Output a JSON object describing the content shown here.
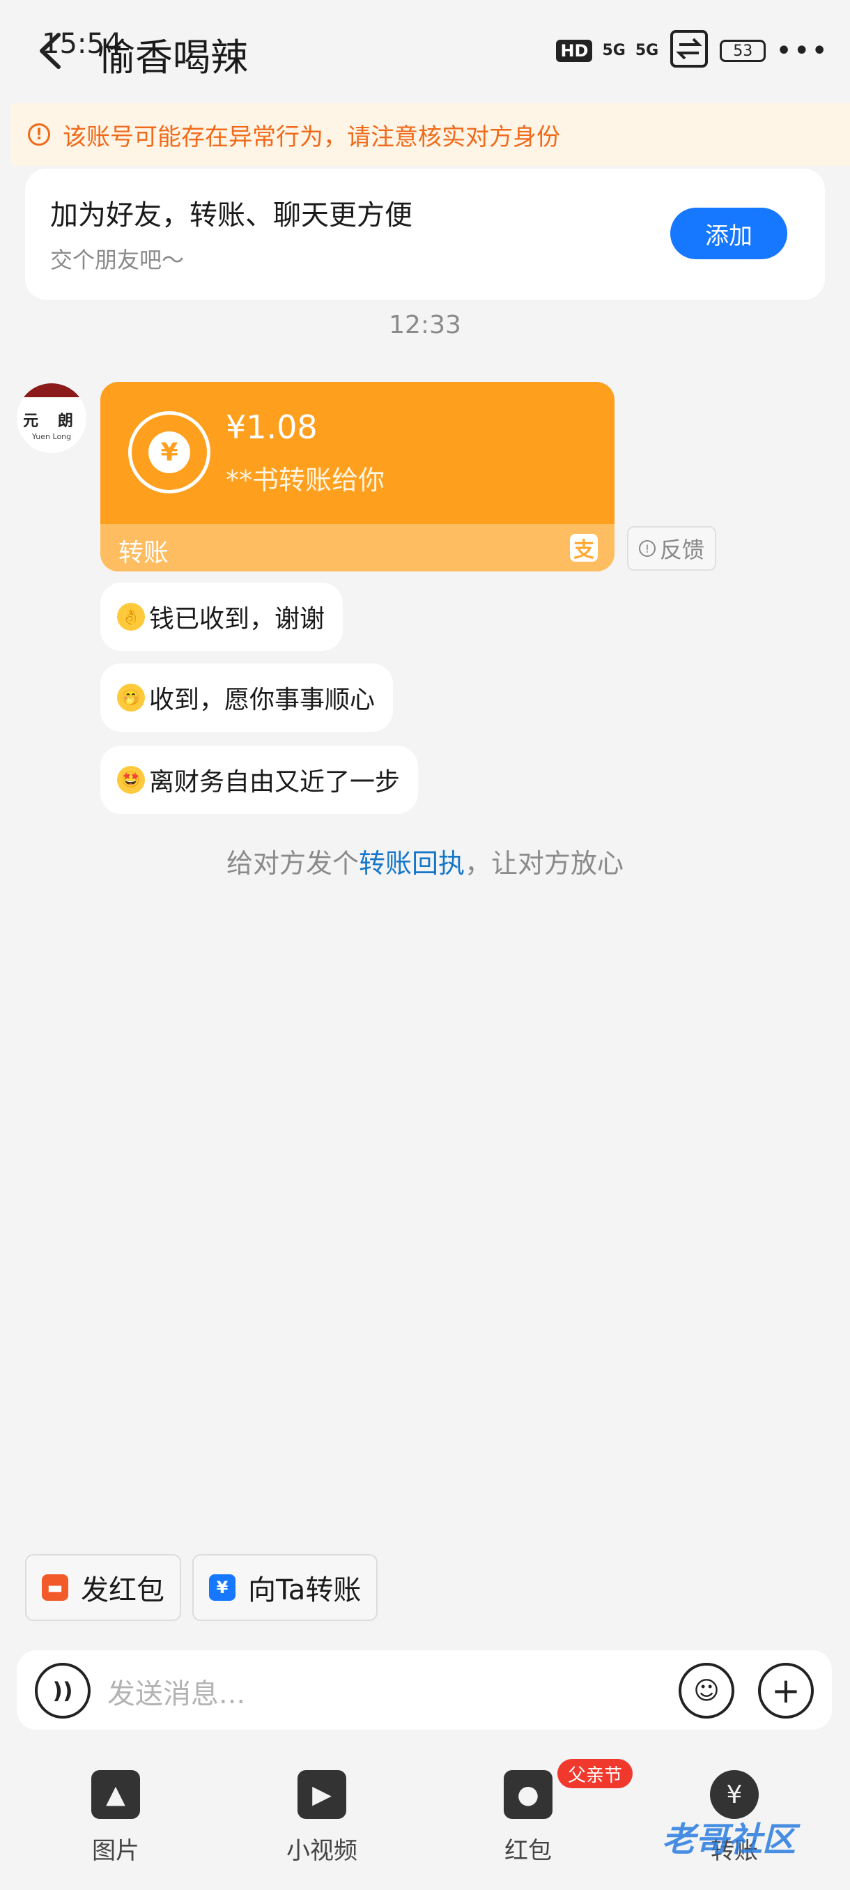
{
  "status_bar": {
    "time": "15:54",
    "hd": "HD",
    "signal1": "5G",
    "signal2": "5G",
    "battery": "53"
  },
  "header": {
    "title": "愉香喝辣"
  },
  "warning": {
    "text": "该账号可能存在异常行为，请注意核实对方身份"
  },
  "friend_card": {
    "title": "加为好友，转账、聊天更方便",
    "subtitle": "交个朋友吧～",
    "add_label": "添加"
  },
  "timestamp": "12:33",
  "avatar": {
    "cn": "元 朗",
    "en": "Yuen Long"
  },
  "transfer": {
    "amount": "¥1.08",
    "description": "**书转账给你",
    "footer_label": "转账",
    "feedback_label": "反馈",
    "brand_color": "#ff9f1e"
  },
  "messages": [
    {
      "emoji": "ok-hand-emoji",
      "text": "钱已收到，谢谢"
    },
    {
      "emoji": "thinking-face-emoji",
      "text": "收到，愿你事事顺心"
    },
    {
      "emoji": "star-struck-emoji",
      "text": "离财务自由又近了一步"
    }
  ],
  "receipt_tip": {
    "prefix": "给对方发个",
    "link": "转账回执",
    "suffix": "，让对方放心"
  },
  "quick_actions": {
    "red_packet": "发红包",
    "transfer_to": "向Ta转账"
  },
  "input": {
    "placeholder": "发送消息..."
  },
  "toolbar": {
    "items": [
      "图片",
      "小视频",
      "红包",
      "转账"
    ],
    "badge": "父亲节"
  },
  "watermark": "老哥社区"
}
